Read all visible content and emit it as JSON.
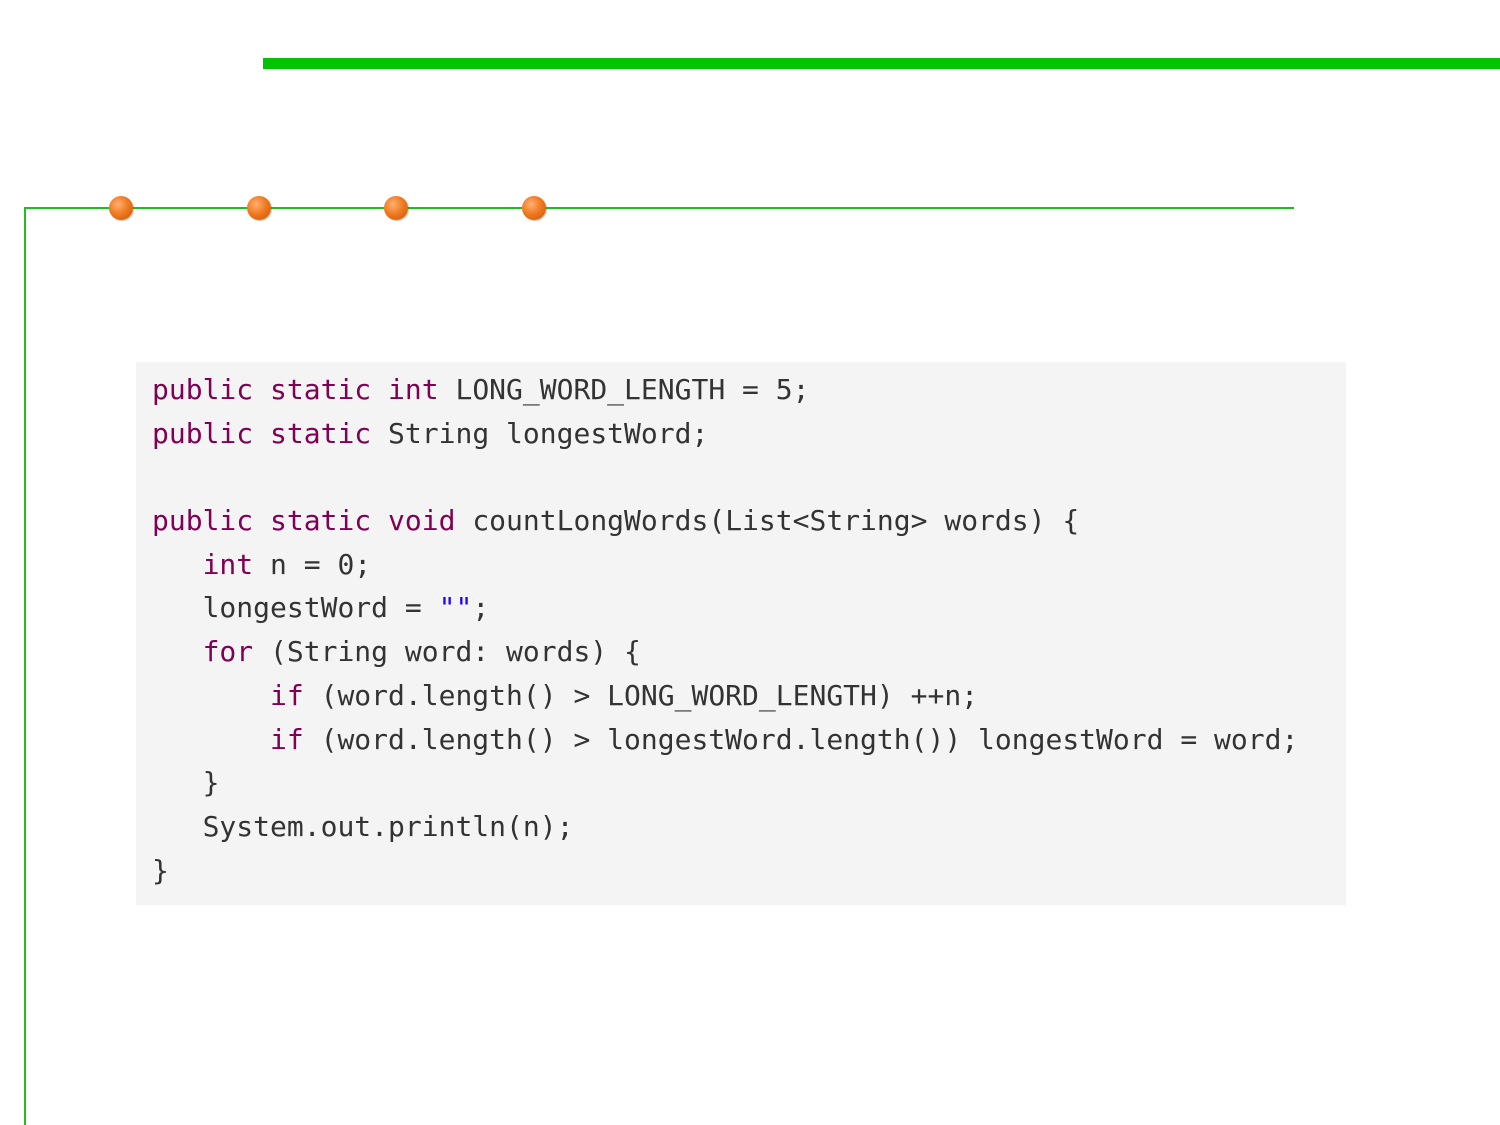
{
  "colors": {
    "top_bar": "#00c400",
    "rule_lines": "#22bb22",
    "bullet_dots": "#f07a22",
    "code_background": "#f4f4f4",
    "keyword": "#7f0055",
    "string_literal": "#2a00ff",
    "code_text": "#333333"
  },
  "code": {
    "language": "java",
    "lines": [
      {
        "indent": "",
        "tokens": [
          {
            "t": "public",
            "k": "kw"
          },
          {
            "t": " "
          },
          {
            "t": "static",
            "k": "kw"
          },
          {
            "t": " "
          },
          {
            "t": "int",
            "k": "kw"
          },
          {
            "t": " LONG_WORD_LENGTH = 5;"
          }
        ]
      },
      {
        "indent": "",
        "tokens": [
          {
            "t": "public",
            "k": "kw"
          },
          {
            "t": " "
          },
          {
            "t": "static",
            "k": "kw"
          },
          {
            "t": " String longestWord;"
          }
        ]
      },
      {
        "indent": "",
        "tokens": []
      },
      {
        "indent": "",
        "tokens": [
          {
            "t": "public",
            "k": "kw"
          },
          {
            "t": " "
          },
          {
            "t": "static",
            "k": "kw"
          },
          {
            "t": " "
          },
          {
            "t": "void",
            "k": "kw"
          },
          {
            "t": " countLongWords(List<String> words) {"
          }
        ]
      },
      {
        "indent": "   ",
        "tokens": [
          {
            "t": "int",
            "k": "kw"
          },
          {
            "t": " n = 0;"
          }
        ]
      },
      {
        "indent": "   ",
        "tokens": [
          {
            "t": "longestWord = "
          },
          {
            "t": "\"\"",
            "k": "str"
          },
          {
            "t": ";"
          }
        ]
      },
      {
        "indent": "   ",
        "tokens": [
          {
            "t": "for",
            "k": "kw"
          },
          {
            "t": " (String word: words) {"
          }
        ]
      },
      {
        "indent": "       ",
        "tokens": [
          {
            "t": "if",
            "k": "kw"
          },
          {
            "t": " (word.length() > LONG_WORD_LENGTH) ++n;"
          }
        ]
      },
      {
        "indent": "       ",
        "tokens": [
          {
            "t": "if",
            "k": "kw"
          },
          {
            "t": " (word.length() > longestWord.length()) longestWord = word;"
          }
        ]
      },
      {
        "indent": "   ",
        "tokens": [
          {
            "t": "}"
          }
        ]
      },
      {
        "indent": "   ",
        "tokens": [
          {
            "t": "System.out.println(n);"
          }
        ]
      },
      {
        "indent": "",
        "tokens": [
          {
            "t": "}"
          }
        ]
      }
    ]
  }
}
